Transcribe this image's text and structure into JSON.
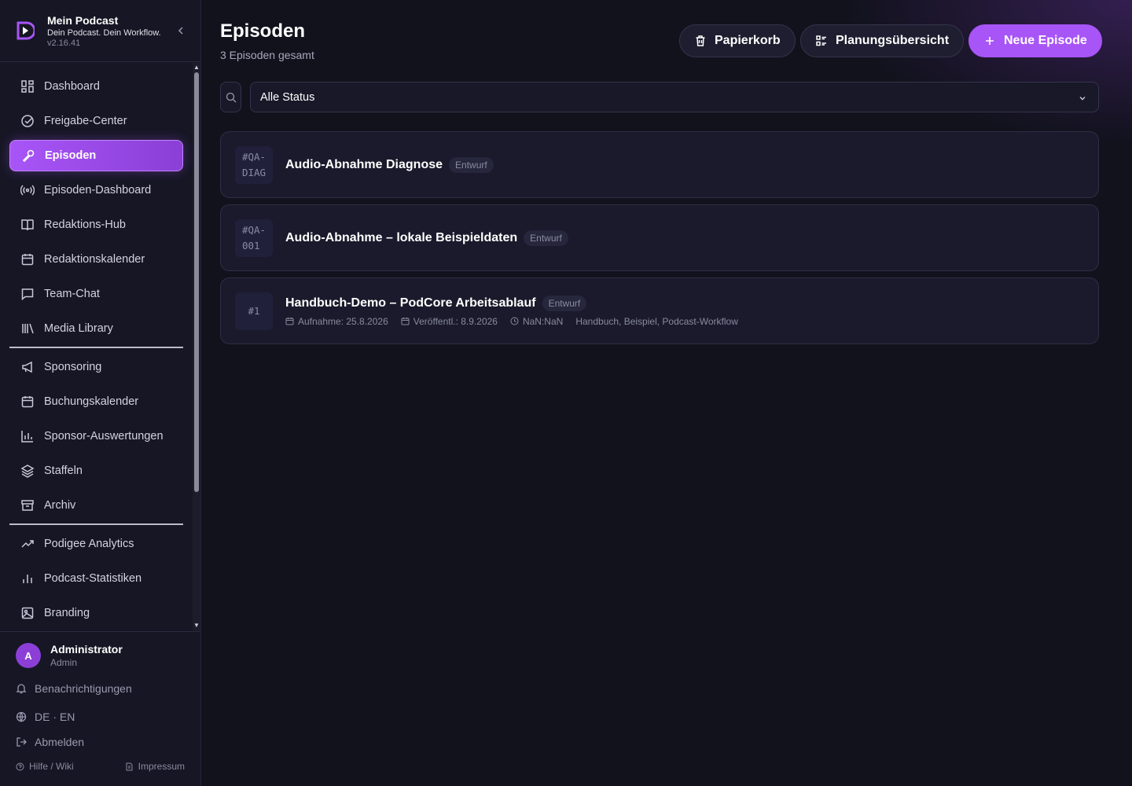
{
  "brand": {
    "name": "Mein Podcast",
    "tagline": "Dein Podcast. Dein Workflow.",
    "version": "v2.16.41"
  },
  "colors": {
    "accent": "#a855f7",
    "background": "#12121d",
    "sidebar": "#161624"
  },
  "nav": {
    "items": [
      {
        "label": "Dashboard",
        "icon": "dashboard-icon"
      },
      {
        "label": "Freigabe-Center",
        "icon": "check-circle-icon"
      },
      {
        "label": "Episoden",
        "icon": "mic-icon",
        "active": true
      },
      {
        "label": "Episoden-Dashboard",
        "icon": "broadcast-icon"
      },
      {
        "label": "Redaktions-Hub",
        "icon": "book-icon"
      },
      {
        "label": "Redaktionskalender",
        "icon": "calendar-icon"
      },
      {
        "label": "Team-Chat",
        "icon": "chat-icon"
      },
      {
        "label": "Media Library",
        "icon": "library-icon"
      },
      {
        "label": "Sponsoring",
        "icon": "megaphone-icon"
      },
      {
        "label": "Buchungskalender",
        "icon": "calendar-icon"
      },
      {
        "label": "Sponsor-Auswertungen",
        "icon": "bar-chart-icon"
      },
      {
        "label": "Staffeln",
        "icon": "layers-icon"
      },
      {
        "label": "Archiv",
        "icon": "archive-icon"
      },
      {
        "label": "Podigee Analytics",
        "icon": "trending-up-icon"
      },
      {
        "label": "Podcast-Statistiken",
        "icon": "stats-icon"
      },
      {
        "label": "Branding",
        "icon": "image-icon"
      }
    ]
  },
  "user": {
    "initial": "A",
    "name": "Administrator",
    "role": "Admin"
  },
  "utility": {
    "notifications": "Benachrichtigungen",
    "language": "DE · EN",
    "logout": "Abmelden"
  },
  "footer": {
    "help": "Hilfe / Wiki",
    "imprint": "Impressum"
  },
  "header": {
    "title": "Episoden",
    "subtitle": "3 Episoden gesamt"
  },
  "actions": {
    "trash": "Papierkorb",
    "planning": "Planungsübersicht",
    "new_episode": "Neue Episode"
  },
  "filter": {
    "status": "Alle Status"
  },
  "episodes": [
    {
      "number_line1": "#QA-",
      "number_line2": "DIAG",
      "title": "Audio-Abnahme Diagnose",
      "status": "Entwurf"
    },
    {
      "number_line1": "#QA-",
      "number_line2": "001",
      "title": "Audio-Abnahme – lokale Beispieldaten",
      "status": "Entwurf"
    },
    {
      "number_line1": "#1",
      "title": "Handbuch-Demo – PodCore Arbeitsablauf",
      "status": "Entwurf",
      "recorded": "Aufnahme: 25.8.2026",
      "published": "Veröffentl.: 8.9.2026",
      "duration": "NaN:NaN",
      "tags": "Handbuch, Beispiel, Podcast-Workflow"
    }
  ]
}
